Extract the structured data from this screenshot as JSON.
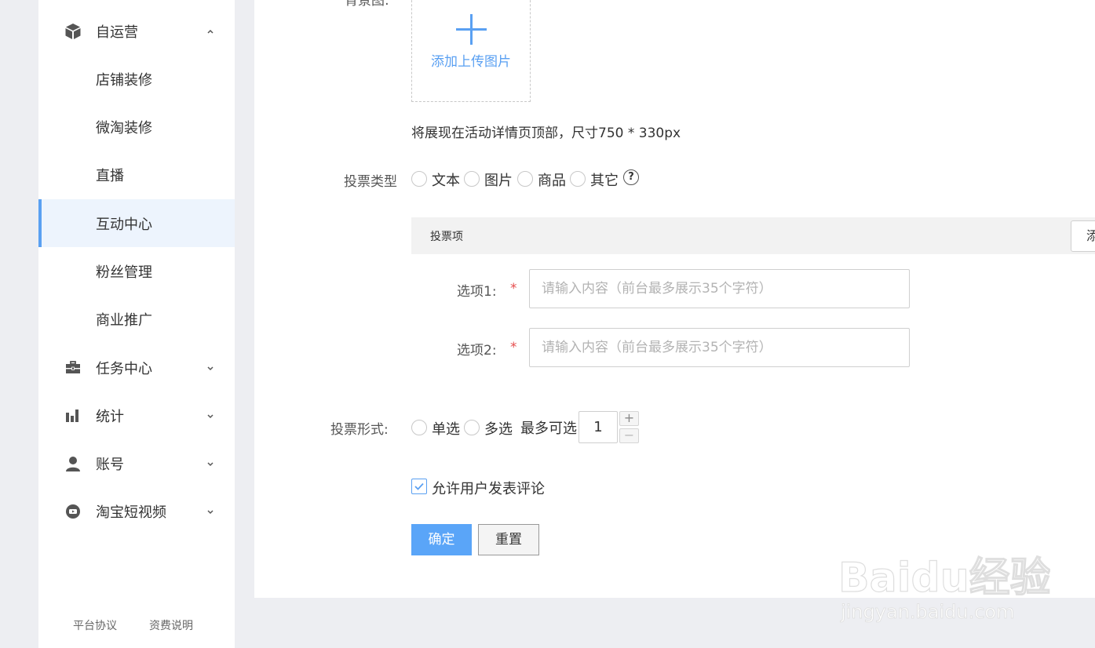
{
  "sidebar": {
    "items": [
      {
        "label": "自运营",
        "icon": "cube-icon",
        "expanded": true
      },
      {
        "label": "店铺装修"
      },
      {
        "label": "微淘装修"
      },
      {
        "label": "直播"
      },
      {
        "label": "互动中心",
        "active": true
      },
      {
        "label": "粉丝管理"
      },
      {
        "label": "商业推广"
      },
      {
        "label": "任务中心",
        "icon": "briefcase-icon"
      },
      {
        "label": "统计",
        "icon": "bar-chart-icon"
      },
      {
        "label": "账号",
        "icon": "user-icon"
      },
      {
        "label": "淘宝短视频",
        "icon": "video-icon"
      }
    ],
    "footer": {
      "agreement": "平台协议",
      "fees": "资费说明"
    }
  },
  "form": {
    "background_label": "背景图:",
    "upload_text": "添加上传图片",
    "background_hint": "将展现在活动详情页顶部，尺寸750 * 330px",
    "vote_type_label": "投票类型",
    "vote_types": [
      "文本",
      "图片",
      "商品",
      "其它"
    ],
    "help_symbol": "?",
    "vote_items_title": "投票项",
    "add_button": "添加",
    "options": [
      {
        "label": "选项1:",
        "placeholder": "请输入内容（前台最多展示35个字符）"
      },
      {
        "label": "选项2:",
        "placeholder": "请输入内容（前台最多展示35个字符）"
      }
    ],
    "required_mark": "*",
    "vote_form_label": "投票形式:",
    "vote_forms": [
      "单选",
      "多选"
    ],
    "max_select_label": "最多可选",
    "max_select_value": "1",
    "stepper_plus": "+",
    "stepper_minus": "−",
    "allow_comment_label": "允许用户发表评论",
    "allow_comment_checked": true,
    "confirm_label": "确定",
    "reset_label": "重置"
  },
  "watermark": {
    "brand": "Baidu经验",
    "url": "jingyan.baidu.com"
  },
  "colors": {
    "accent": "#5aa0f2",
    "required": "#e64d4d",
    "active_bg": "#edf4fd"
  }
}
